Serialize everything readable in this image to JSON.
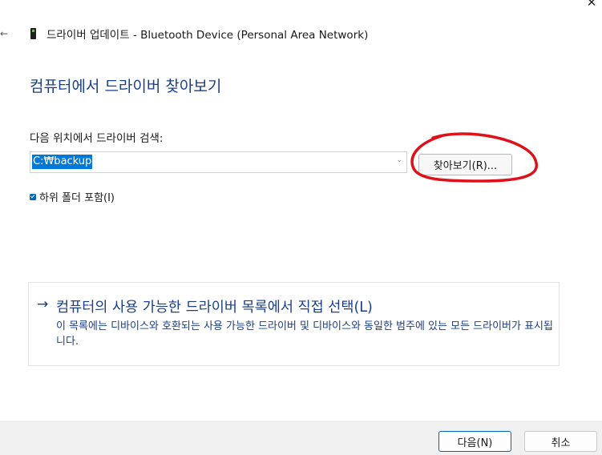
{
  "window": {
    "close_glyph": "✕",
    "back_glyph": "←",
    "title": "드라이버 업데이트 - Bluetooth Device (Personal Area Network)",
    "device_icon": "bluetooth-device-icon"
  },
  "main": {
    "heading": "컴퓨터에서 드라이버 찾아보기",
    "search_label": "다음 위치에서 드라이버 검색:",
    "path_value": "C:₩backup",
    "dropdown_glyph": "⌄",
    "browse_label": "찾아보기(R)...",
    "include_subfolders_label": "하위 폴더 포함(I)",
    "include_subfolders_checked": true
  },
  "pick_option": {
    "arrow_glyph": "→",
    "title": "컴퓨터의 사용 가능한 드라이버 목록에서 직접 선택(L)",
    "description": "이 목록에는 디바이스와 호환되는 사용 가능한 드라이버 및 디바이스와 동일한 범주에 있는 모든 드라이버가 표시됩니다."
  },
  "footer": {
    "next_label": "다음(N)",
    "cancel_label": "취소"
  },
  "colors": {
    "accent": "#0067c0",
    "heading_blue": "#1a3f8a",
    "selection": "#0078d7",
    "annotation_red": "#e0101a",
    "footer_bg": "#f0f0f0"
  }
}
